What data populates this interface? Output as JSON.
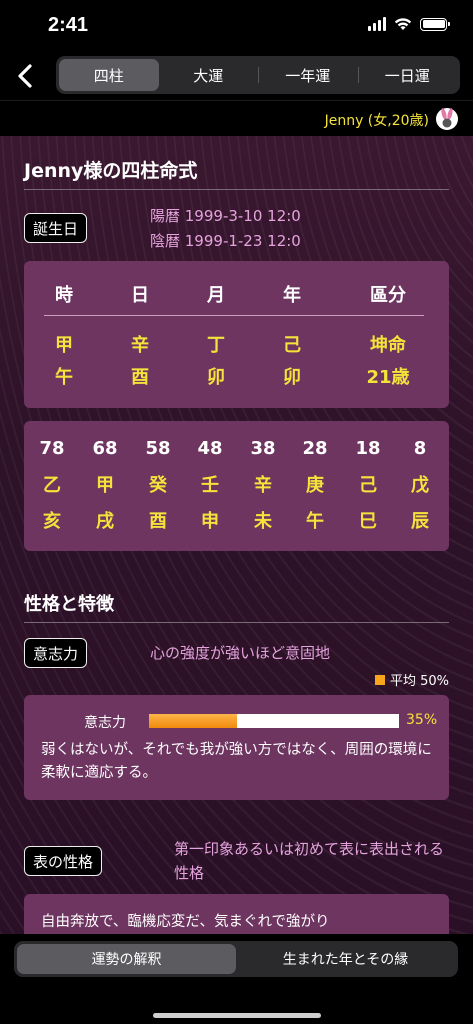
{
  "status": {
    "time": "2:41"
  },
  "nav": {
    "tabs": [
      "四柱",
      "大運",
      "一年運",
      "一日運"
    ],
    "active_tab": "四柱"
  },
  "user": {
    "label": "Jenny (女,20歳)"
  },
  "chart": {
    "title": "Jenny様の四柱命式",
    "birth_tag": "誕生日",
    "solar": "陽暦 1999-3-10 12:0",
    "lunar": "陰暦 1999-1-23 12:0",
    "pillars": {
      "headers": [
        "時",
        "日",
        "月",
        "年",
        "區分"
      ],
      "stems": [
        "甲",
        "辛",
        "丁",
        "己",
        "坤命"
      ],
      "branches": [
        "午",
        "酉",
        "卯",
        "卯",
        "21歳"
      ]
    },
    "luck": {
      "ages": [
        "78",
        "68",
        "58",
        "48",
        "38",
        "28",
        "18",
        "8"
      ],
      "stems": [
        "乙",
        "甲",
        "癸",
        "壬",
        "辛",
        "庚",
        "己",
        "戊"
      ],
      "branches": [
        "亥",
        "戌",
        "酉",
        "申",
        "未",
        "午",
        "巳",
        "辰"
      ]
    }
  },
  "personality": {
    "title": "性格と特徴",
    "will": {
      "tag": "意志力",
      "desc": "心の強度が強いほど意固地",
      "avg_label": "平均 50%",
      "bar_label": "意志力",
      "value_percent": 35,
      "value_label": "35%",
      "text": "弱くはないが、それでも我が強い方ではなく、周囲の環境に柔軟に適応する。"
    },
    "surface": {
      "tag": "表の性格",
      "desc": "第一印象あるいは初めて表に表出される性格",
      "text": "自由奔放で、臨機応変だ、気まぐれで強がり"
    }
  },
  "bottom_tabs": {
    "items": [
      "運勢の解釈",
      "生まれた年とその縁"
    ],
    "active": "運勢の解釈"
  },
  "colors": {
    "accent_yellow": "#f4e33a",
    "panel": "#6e3561",
    "pink_text": "#e5a3dd",
    "bar_fill": "#f7a51c"
  }
}
